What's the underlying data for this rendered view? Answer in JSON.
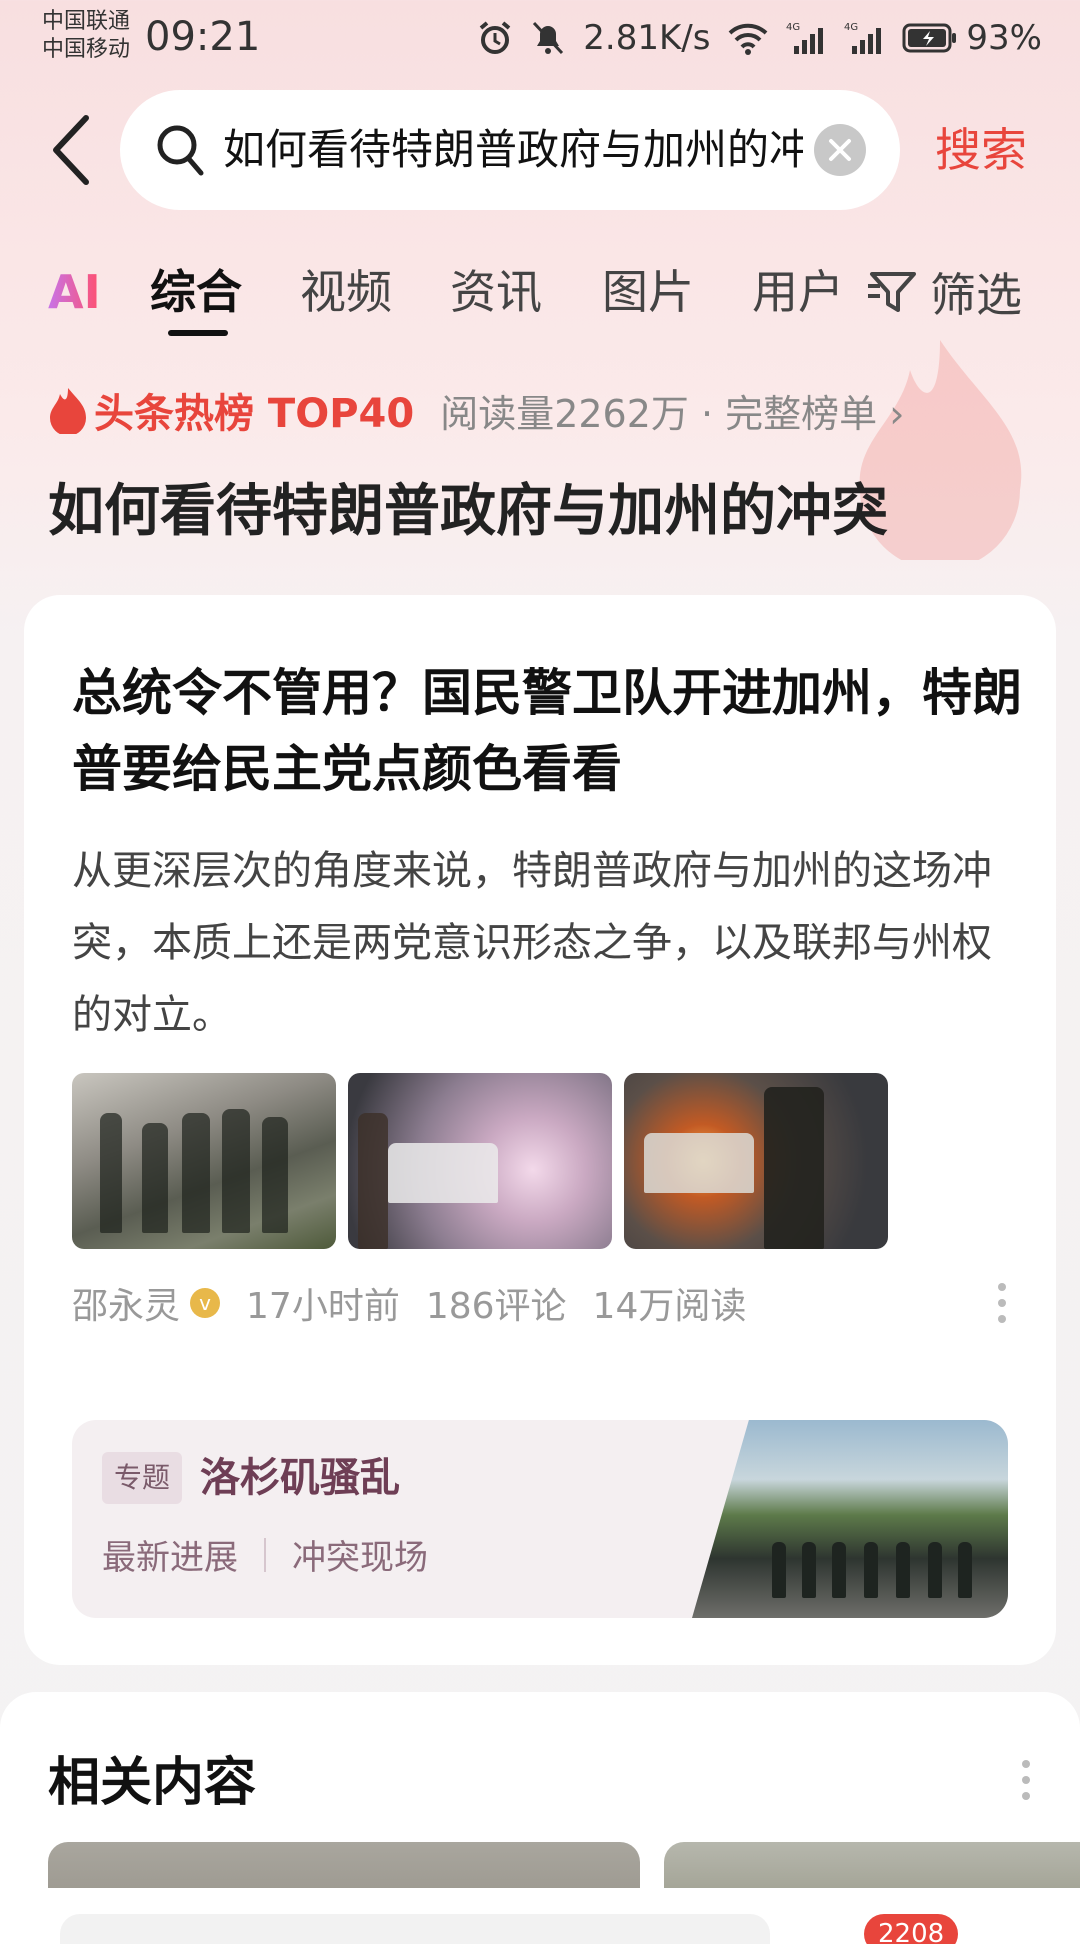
{
  "status_bar": {
    "carrier1": "中国联通",
    "carrier2": "中国移动",
    "time": "09:21",
    "net_speed": "2.81K/s",
    "battery": "93%"
  },
  "search": {
    "query": "如何看待特朗普政府与加州的冲突",
    "button_label": "搜索"
  },
  "tabs": {
    "ai": "AI",
    "items": [
      "综合",
      "视频",
      "资讯",
      "图片",
      "用户"
    ],
    "active": "综合",
    "filter_label": "筛选"
  },
  "hot": {
    "label": "头条热榜 TOP40",
    "stats": "阅读量2262万 · 完整榜单 ›",
    "title": "如何看待特朗普政府与加州的冲突"
  },
  "article": {
    "title": "总统令不管用？国民警卫队开进加州，特朗普要给民主党点颜色看看",
    "summary": "从更深层次的角度来说，特朗普政府与加州的这场冲突，本质上还是两党意识形态之争，以及联邦与州权的对立。",
    "author": "邵永灵",
    "verified_mark": "v",
    "time": "17小时前",
    "comments": "186评论",
    "reads": "14万阅读"
  },
  "topic": {
    "tag": "专题",
    "title": "洛杉矶骚乱",
    "link1": "最新进展",
    "link2": "冲突现场"
  },
  "related": {
    "title": "相关内容",
    "badge": "2208"
  },
  "colors": {
    "accent": "#e8453c",
    "topic_title": "#6e3e55"
  }
}
